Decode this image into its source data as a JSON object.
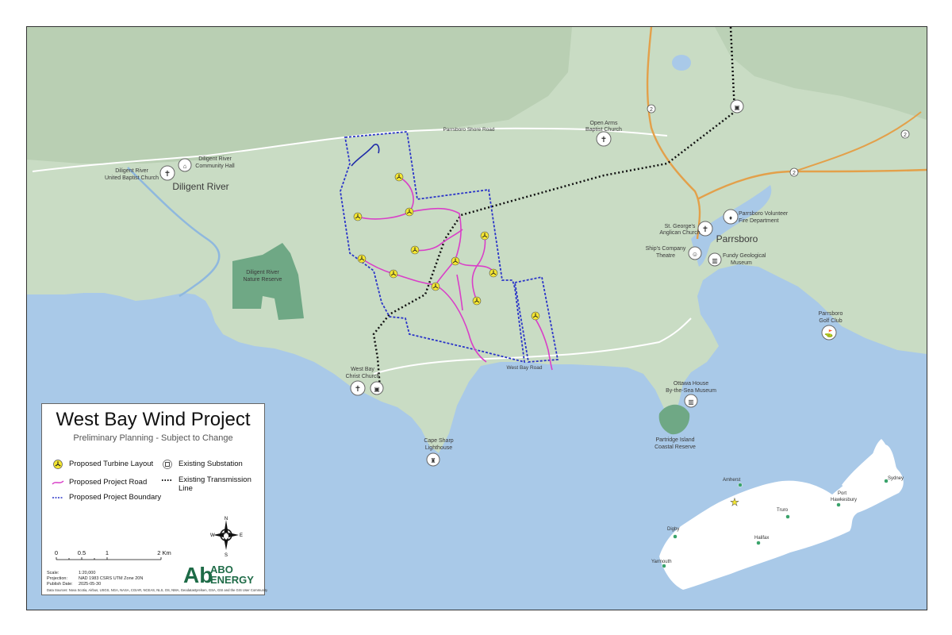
{
  "title": "West Bay Wind Project",
  "subtitle": "Preliminary Planning - Subject to Change",
  "legend": {
    "turbine": "Proposed Turbine Layout",
    "substation": "Existing Substation",
    "road": "Proposed Project Road",
    "transmission_line1": "Existing Transmission",
    "transmission_line2": "Line",
    "boundary": "Proposed Project Boundary"
  },
  "scale_ticks": [
    "0",
    "0.5",
    "1",
    "2 Km"
  ],
  "meta": {
    "scale_label": "Scale:",
    "scale_value": "1:20,000",
    "projection_label": "Projection:",
    "projection_value": "NAD 1983 CSRS UTM Zone 20N",
    "publish_label": "Publish Date:",
    "publish_value": "2025-05-30"
  },
  "sources": "Data Sources: Nova Scotia, Airbus, USGS, NGA, NASA, CGIAR, NCEAS, NLS, OS, NMA, Geodatastyrelsen, GSA, GSI and the GIS User Community",
  "compass": {
    "n": "N",
    "s": "S",
    "e": "E",
    "w": "W"
  },
  "logo": {
    "mark": "Ab",
    "line1": "ABO",
    "line2": "ENERGY"
  },
  "map_labels": {
    "diligent_river": "Diligent River",
    "diligent_church1": "Diligent River",
    "diligent_church2": "United Baptist Church",
    "community_hall1": "Diligent River",
    "community_hall2": "Community Hall",
    "open_arms1": "Open Arms",
    "open_arms2": "Baptist  Church",
    "shore_road": "Parrsboro Shore Road",
    "parrsboro": "Parrsboro",
    "st_georges1": "St. George's",
    "st_georges2": "Anglican Church",
    "fire1": "Parrsboro Volunteer",
    "fire2": "Fire Department",
    "ships1": "Ship's Company",
    "ships2": "Theatre",
    "fundy1": "Fundy Geological",
    "fundy2": "Museum",
    "golf1": "Parrsboro",
    "golf2": "Golf Club",
    "west_bay_church1": "West Bay",
    "west_bay_church2": "Christ Church",
    "west_bay_road": "West Bay Road",
    "ottawa1": "Ottawa House",
    "ottawa2": "By-the-Sea Museum",
    "cape_sharp1": "Cape Sharp",
    "cape_sharp2": "Lighthouse",
    "reserve1": "Diligent River",
    "reserve2": "Nature Reserve",
    "partridge1": "Partridge Island",
    "partridge2": "Coastal Reserve",
    "route2": "2"
  },
  "inset_labels": {
    "amherst": "Amherst",
    "truro": "Truro",
    "port_hawkesbury1": "Port",
    "port_hawkesbury2": "Hawkesbury",
    "sydney": "Sydney",
    "digby": "Digby",
    "halifax": "Halifax",
    "yarmouth": "Yarmouth"
  },
  "colors": {
    "land": "#c9dcc4",
    "water": "#a9c9e8",
    "road_project": "#d93fc8",
    "boundary": "#2b35c8",
    "turbine": "#f4e631",
    "transmission": "#111111",
    "highway": "#e3a04a",
    "reserve": "#6fa885",
    "logo": "#1e6b47"
  },
  "icons": [
    "turbine-icon",
    "substation-icon",
    "church-icon",
    "hall-icon",
    "fire-icon",
    "museum-icon",
    "theatre-icon",
    "golf-icon",
    "lighthouse-icon",
    "star-icon"
  ]
}
